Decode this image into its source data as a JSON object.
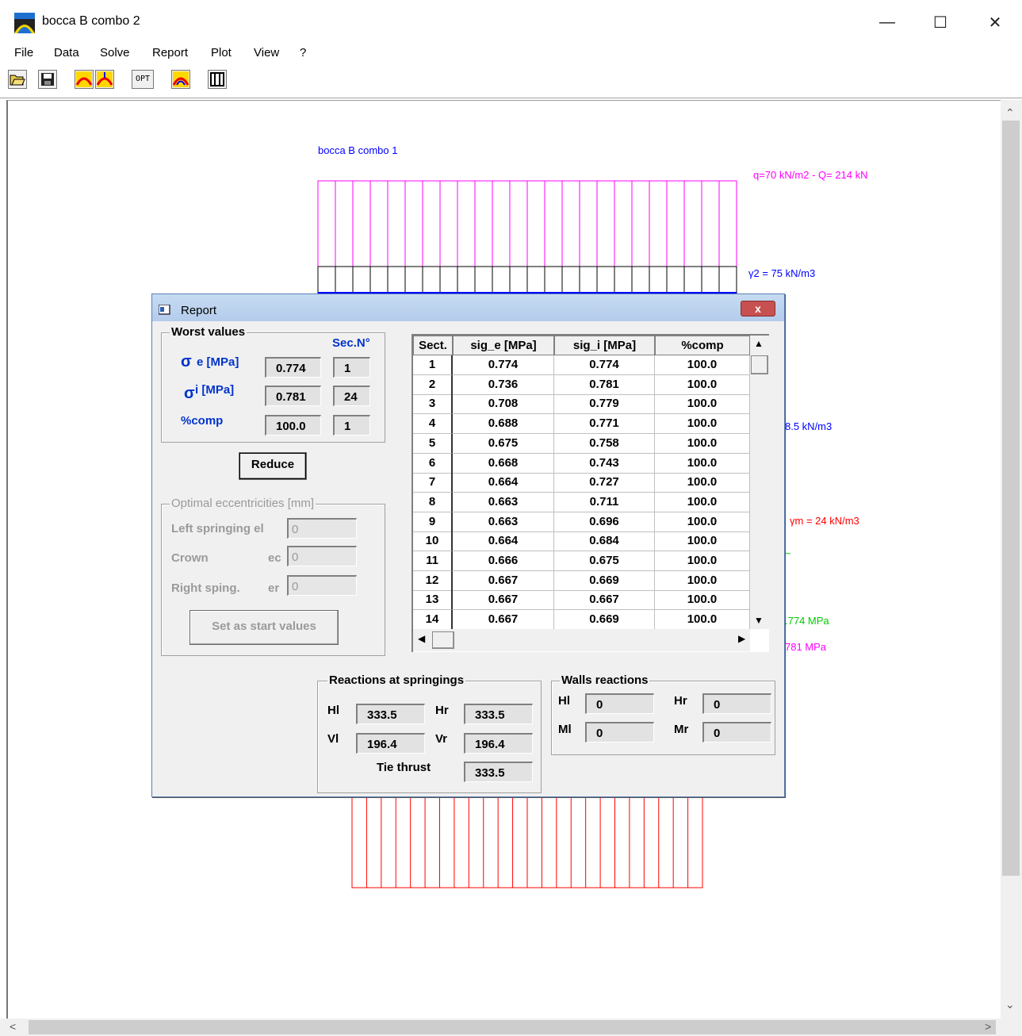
{
  "window": {
    "title": "bocca B combo 2",
    "minimize": "—",
    "maximize": "☐",
    "close": "✕"
  },
  "menu": [
    "File",
    "Data",
    "Solve",
    "Report",
    "Plot",
    "View",
    "?"
  ],
  "toolbar": {
    "opt_label": "OPT"
  },
  "drawing": {
    "title": "bocca B combo 1",
    "load_label": "q=70 kN/m2 - Q= 214 kN",
    "gamma2_label": "γ2 = 75 kN/m3",
    "gamma1_label_partial": "8.5 kN/m3",
    "gammam_label": "γm = 24 kN/m3",
    "sig_e_label_partial": ".774 MPa",
    "sig_i_label_partial": "781 MPa",
    "green_tick": "~",
    "colors": {
      "blue": "#0000ff",
      "magenta": "#ff00ff",
      "red": "#ff0000",
      "green": "#00cc00"
    }
  },
  "dialog": {
    "title": "Report",
    "close": "x",
    "worst": {
      "group_label": "Worst values",
      "secn_header": "Sec.N°",
      "sigma_symbol": "σ",
      "sig_e_label": "e [MPa]",
      "sig_i_label": " i [MPa]",
      "comp_label": "%comp",
      "sig_e_value": "0.774",
      "sig_e_sec": "1",
      "sig_i_value": "0.781",
      "sig_i_sec": "24",
      "comp_value": "100.0",
      "comp_sec": "1"
    },
    "reduce_button": "Reduce",
    "optimal": {
      "group_label": "Optimal eccentricities [mm]",
      "left_label": "Left springing el",
      "crown_label": "Crown",
      "crown_suffix": "ec",
      "right_label": "Right sping.",
      "right_suffix": "er",
      "left_value": "0",
      "crown_value": "0",
      "right_value": "0",
      "set_button": "Set as start values"
    },
    "table": {
      "headers": [
        "Sect.",
        "sig_e [MPa]",
        "sig_i [MPa]",
        "%comp"
      ],
      "rows": [
        [
          "1",
          "0.774",
          "0.774",
          "100.0"
        ],
        [
          "2",
          "0.736",
          "0.781",
          "100.0"
        ],
        [
          "3",
          "0.708",
          "0.779",
          "100.0"
        ],
        [
          "4",
          "0.688",
          "0.771",
          "100.0"
        ],
        [
          "5",
          "0.675",
          "0.758",
          "100.0"
        ],
        [
          "6",
          "0.668",
          "0.743",
          "100.0"
        ],
        [
          "7",
          "0.664",
          "0.727",
          "100.0"
        ],
        [
          "8",
          "0.663",
          "0.711",
          "100.0"
        ],
        [
          "9",
          "0.663",
          "0.696",
          "100.0"
        ],
        [
          "10",
          "0.664",
          "0.684",
          "100.0"
        ],
        [
          "11",
          "0.666",
          "0.675",
          "100.0"
        ],
        [
          "12",
          "0.667",
          "0.669",
          "100.0"
        ],
        [
          "13",
          "0.667",
          "0.667",
          "100.0"
        ],
        [
          "14",
          "0.667",
          "0.669",
          "100.0"
        ]
      ]
    },
    "reactions": {
      "group_label": "Reactions at springings",
      "hl_label": "Hl",
      "hl_value": "333.5",
      "hr_label": "Hr",
      "hr_value": "333.5",
      "vl_label": "Vl",
      "vl_value": "196.4",
      "vr_label": "Vr",
      "vr_value": "196.4",
      "tie_label": "Tie thrust",
      "tie_value": "333.5"
    },
    "walls": {
      "group_label": "Walls reactions",
      "hl_label": "Hl",
      "hl_value": "0",
      "hr_label": "Hr",
      "hr_value": "0",
      "ml_label": "Ml",
      "ml_value": "0",
      "mr_label": "Mr",
      "mr_value": "0"
    }
  }
}
